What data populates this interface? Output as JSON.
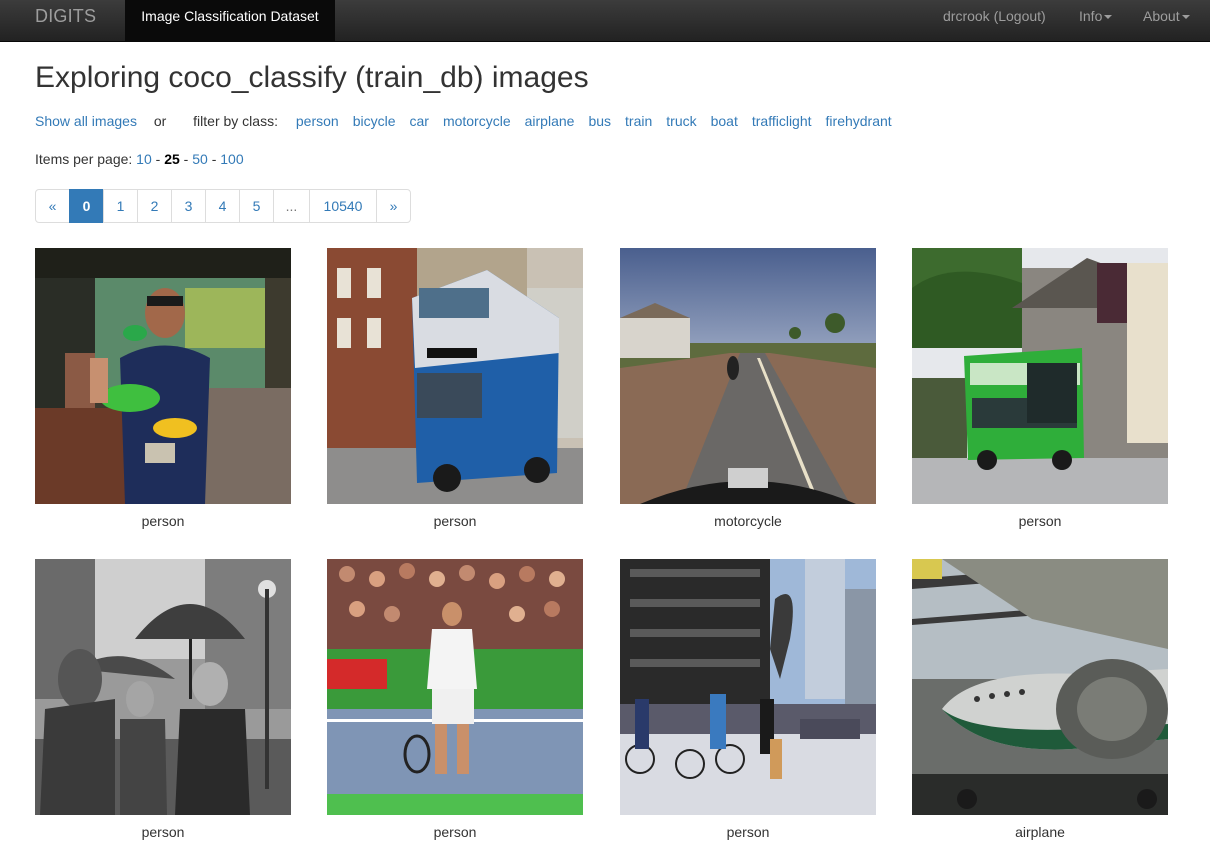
{
  "navbar": {
    "brand": "DIGITS",
    "active_tab": "Image Classification Dataset",
    "user": "drcrook (Logout)",
    "info": "Info",
    "about": "About"
  },
  "title": "Exploring coco_classify (train_db) images",
  "filter": {
    "show_all": "Show all images",
    "or": "or",
    "filter_by": "filter by class:",
    "classes": [
      "person",
      "bicycle",
      "car",
      "motorcycle",
      "airplane",
      "bus",
      "train",
      "truck",
      "boat",
      "trafficlight",
      "firehydrant"
    ]
  },
  "items_per_page": {
    "label": "Items per page:",
    "options": [
      "10",
      "25",
      "50",
      "100"
    ],
    "selected": "25",
    "separator": "-"
  },
  "pagination": {
    "prev": "«",
    "pages": [
      "0",
      "1",
      "2",
      "3",
      "4",
      "5",
      "...",
      "10540"
    ],
    "current": "0",
    "next": "»"
  },
  "images": [
    {
      "label": "person",
      "subject": "man holding parrots"
    },
    {
      "label": "person",
      "subject": "blue double-decker bus on street"
    },
    {
      "label": "motorcycle",
      "subject": "road viewed from motorcycle"
    },
    {
      "label": "person",
      "subject": "green double-decker bus by inn"
    },
    {
      "label": "person",
      "subject": "people with umbrellas in rain"
    },
    {
      "label": "person",
      "subject": "tennis player on court"
    },
    {
      "label": "person",
      "subject": "cyclists in city plaza"
    },
    {
      "label": "airplane",
      "subject": "vintage airliner in hangar"
    }
  ],
  "colors": {
    "link": "#337ab7",
    "navbar": "#222222",
    "active_page": "#337ab7"
  }
}
